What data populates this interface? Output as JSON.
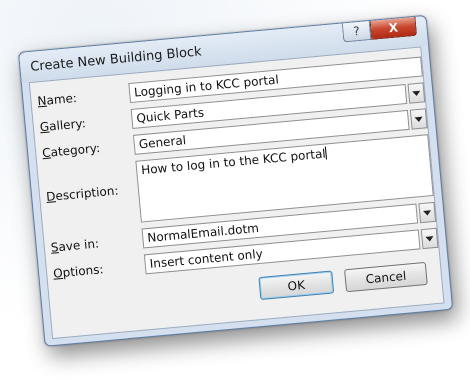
{
  "dialog": {
    "title": "Create New Building Block",
    "help_button": "?",
    "close_button": "X"
  },
  "form": {
    "name": {
      "label_accel": "N",
      "label_rest": "ame:",
      "value": "Logging in to KCC portal"
    },
    "gallery": {
      "label_accel": "G",
      "label_rest": "allery:",
      "value": "Quick Parts"
    },
    "category": {
      "label_accel": "C",
      "label_rest": "ategory:",
      "value": "General"
    },
    "description": {
      "label_accel": "D",
      "label_rest": "escription:",
      "value": "How to log in to the KCC portal"
    },
    "save_in": {
      "label_accel": "S",
      "label_rest": "ave in:",
      "value": "NormalEmail.dotm"
    },
    "options": {
      "label_accel": "O",
      "label_rest": "ptions:",
      "value": "Insert content only"
    }
  },
  "buttons": {
    "ok": "OK",
    "cancel": "Cancel"
  }
}
